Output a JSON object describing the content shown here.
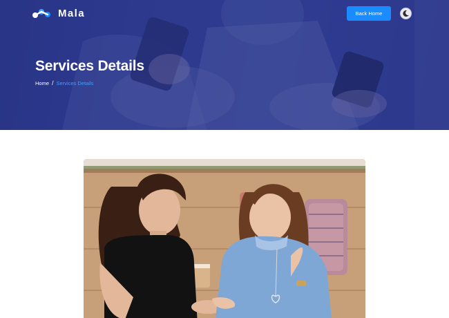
{
  "brand": {
    "name": "Mala",
    "logo_icon": "mala-logo-icon"
  },
  "header": {
    "back_home_label": "Back Home",
    "theme_toggle_icon": "moon-icon"
  },
  "hero": {
    "title": "Services Details",
    "breadcrumb": {
      "home": "Home",
      "separator": "/",
      "current": "Services Details"
    }
  },
  "colors": {
    "hero_overlay": "#2e3a8c",
    "accent": "#1a8cff",
    "breadcrumb_active": "#3da2ff"
  },
  "feature_image": {
    "subject": "two-women-talking-image"
  }
}
